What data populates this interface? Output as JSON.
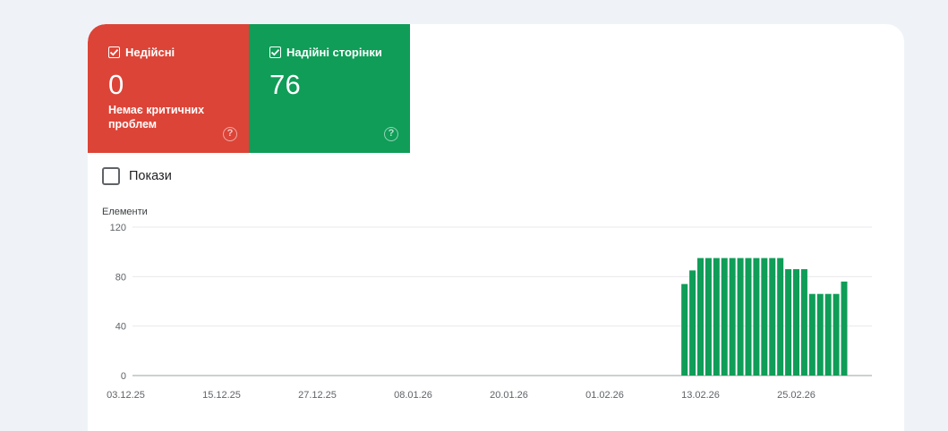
{
  "tiles": {
    "invalid": {
      "label": "Недійсні",
      "value": "0",
      "subtitle": "Немає критичних проблем",
      "color": "#dc4437"
    },
    "valid": {
      "label": "Надійні сторінки",
      "value": "76",
      "color": "#0f9d58"
    }
  },
  "impressions": {
    "label": "Покази"
  },
  "chart_data": {
    "type": "bar",
    "ylabel": "Елементи",
    "ylim": [
      0,
      120
    ],
    "yticks": [
      "120",
      "80",
      "40",
      "0"
    ],
    "ytick_values": [
      120,
      80,
      40,
      0
    ],
    "xtick_labels": [
      "03.12.25",
      "15.12.25",
      "27.12.25",
      "08.01.26",
      "20.01.26",
      "01.02.26",
      "13.02.26",
      "25.02.26"
    ],
    "first_date": "2025-12-03",
    "series": [
      {
        "color": "#0f9d58",
        "points": [
          [
            "2026-02-11",
            74
          ],
          [
            "2026-02-12",
            85
          ],
          [
            "2026-02-13",
            95
          ],
          [
            "2026-02-14",
            95
          ],
          [
            "2026-02-15",
            95
          ],
          [
            "2026-02-16",
            95
          ],
          [
            "2026-02-17",
            95
          ],
          [
            "2026-02-18",
            95
          ],
          [
            "2026-02-19",
            95
          ],
          [
            "2026-02-20",
            95
          ],
          [
            "2026-02-21",
            95
          ],
          [
            "2026-02-22",
            95
          ],
          [
            "2026-02-23",
            95
          ],
          [
            "2026-02-24",
            86
          ],
          [
            "2026-02-25",
            86
          ],
          [
            "2026-02-26",
            86
          ],
          [
            "2026-02-27",
            66
          ],
          [
            "2026-02-28",
            66
          ],
          [
            "2026-03-01",
            66
          ],
          [
            "2026-03-02",
            66
          ],
          [
            "2026-03-03",
            76
          ]
        ]
      }
    ],
    "grid": true
  }
}
